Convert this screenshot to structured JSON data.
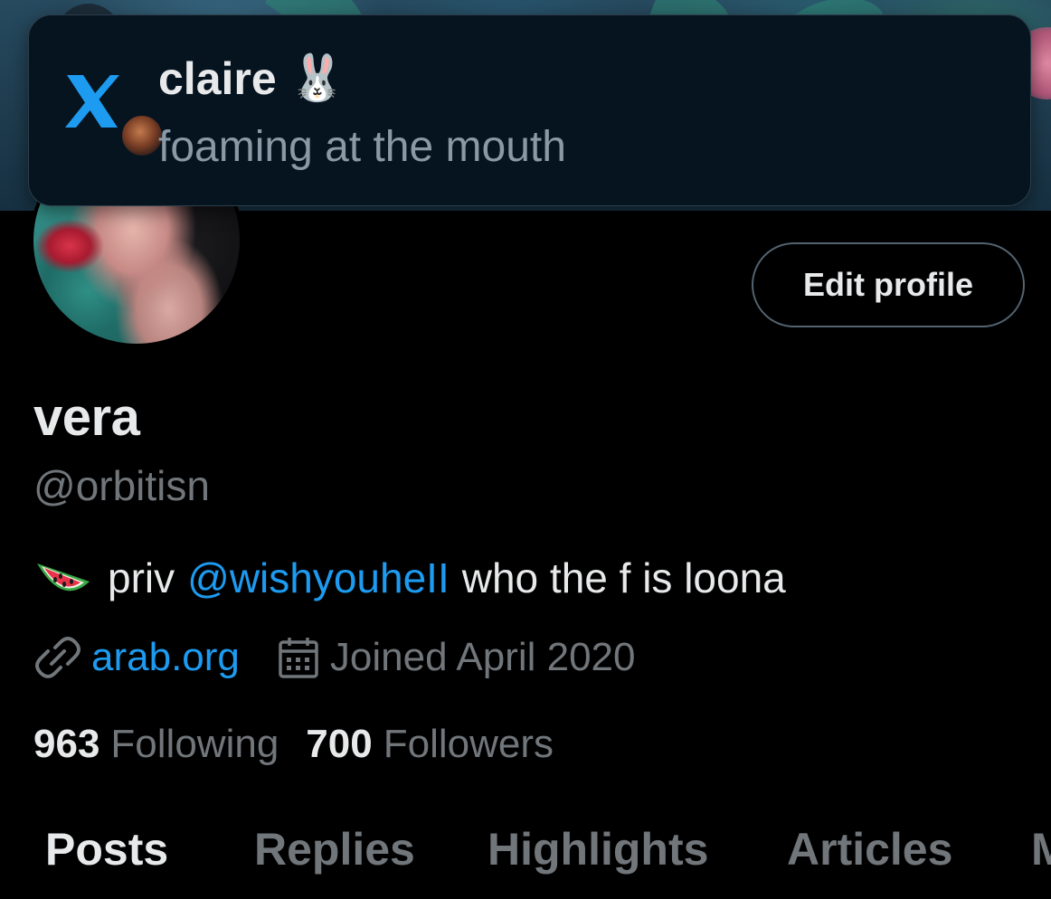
{
  "notification": {
    "app_icon": "x-logo-icon",
    "sender_name": "claire",
    "sender_emoji": "🐰",
    "message": "foaming at the mouth"
  },
  "profile": {
    "display_name": "vera",
    "handle": "@orbitisn",
    "edit_button_label": "Edit profile",
    "bio": {
      "emoji": "watermelon-icon",
      "prefix": "priv",
      "mention": "@wishyouheII",
      "suffix": "who the f is loona"
    },
    "website": "arab.org",
    "joined": "Joined April 2020",
    "following_count": "963",
    "following_label": "Following",
    "followers_count": "700",
    "followers_label": "Followers"
  },
  "tabs": [
    {
      "label": "Posts",
      "active": true
    },
    {
      "label": "Replies",
      "active": false
    },
    {
      "label": "Highlights",
      "active": false
    },
    {
      "label": "Articles",
      "active": false
    },
    {
      "label": "M",
      "active": false
    }
  ],
  "colors": {
    "accent": "#1d9bf0",
    "background": "#000000",
    "primary_text": "#e7e9ea",
    "secondary_text": "#71767b"
  }
}
